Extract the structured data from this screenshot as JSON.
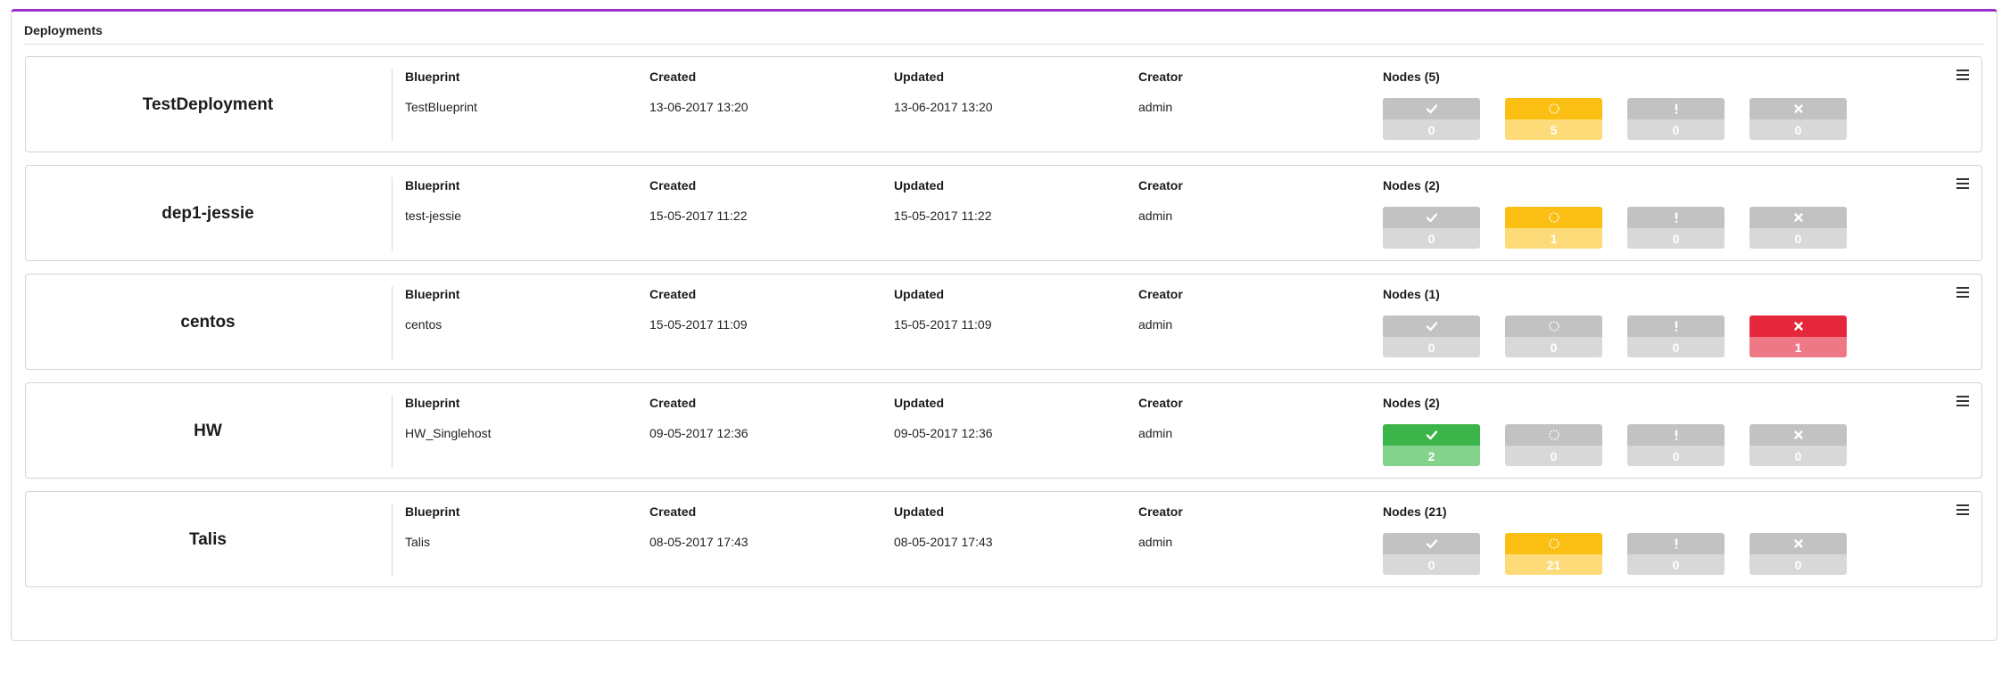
{
  "widget": {
    "title": "Deployments"
  },
  "labels": {
    "blueprint": "Blueprint",
    "created": "Created",
    "updated": "Updated",
    "creator": "Creator"
  },
  "status_colors": {
    "inactive": "#c2c2c2",
    "in_progress": "#fbbf14",
    "ok": "#3bb449",
    "failed": "#e5273b",
    "accent": "#9b30c9"
  },
  "deployments": [
    {
      "name": "TestDeployment",
      "blueprint": "TestBlueprint",
      "created": "13-06-2017 13:20",
      "updated": "13-06-2017 13:20",
      "creator": "admin",
      "nodes_label": "Nodes (5)",
      "states": [
        {
          "icon": "check-icon",
          "count": "0",
          "style": "grey"
        },
        {
          "icon": "spinner-icon",
          "count": "5",
          "style": "yellow"
        },
        {
          "icon": "exclamation-icon",
          "count": "0",
          "style": "grey"
        },
        {
          "icon": "close-icon",
          "count": "0",
          "style": "grey"
        }
      ]
    },
    {
      "name": "dep1-jessie",
      "blueprint": "test-jessie",
      "created": "15-05-2017 11:22",
      "updated": "15-05-2017 11:22",
      "creator": "admin",
      "nodes_label": "Nodes (2)",
      "states": [
        {
          "icon": "check-icon",
          "count": "0",
          "style": "grey"
        },
        {
          "icon": "spinner-icon",
          "count": "1",
          "style": "yellow"
        },
        {
          "icon": "exclamation-icon",
          "count": "0",
          "style": "grey"
        },
        {
          "icon": "close-icon",
          "count": "0",
          "style": "grey"
        }
      ]
    },
    {
      "name": "centos",
      "blueprint": "centos",
      "created": "15-05-2017 11:09",
      "updated": "15-05-2017 11:09",
      "creator": "admin",
      "nodes_label": "Nodes (1)",
      "states": [
        {
          "icon": "check-icon",
          "count": "0",
          "style": "grey"
        },
        {
          "icon": "spinner-icon",
          "count": "0",
          "style": "grey"
        },
        {
          "icon": "exclamation-icon",
          "count": "0",
          "style": "grey"
        },
        {
          "icon": "close-icon",
          "count": "1",
          "style": "red"
        }
      ]
    },
    {
      "name": "HW",
      "blueprint": "HW_Singlehost",
      "created": "09-05-2017 12:36",
      "updated": "09-05-2017 12:36",
      "creator": "admin",
      "nodes_label": "Nodes (2)",
      "states": [
        {
          "icon": "check-icon",
          "count": "2",
          "style": "green"
        },
        {
          "icon": "spinner-icon",
          "count": "0",
          "style": "grey"
        },
        {
          "icon": "exclamation-icon",
          "count": "0",
          "style": "grey"
        },
        {
          "icon": "close-icon",
          "count": "0",
          "style": "grey"
        }
      ]
    },
    {
      "name": "Talis",
      "blueprint": "Talis",
      "created": "08-05-2017 17:43",
      "updated": "08-05-2017 17:43",
      "creator": "admin",
      "nodes_label": "Nodes (21)",
      "states": [
        {
          "icon": "check-icon",
          "count": "0",
          "style": "grey"
        },
        {
          "icon": "spinner-icon",
          "count": "21",
          "style": "yellow"
        },
        {
          "icon": "exclamation-icon",
          "count": "0",
          "style": "grey"
        },
        {
          "icon": "close-icon",
          "count": "0",
          "style": "grey"
        }
      ]
    }
  ]
}
